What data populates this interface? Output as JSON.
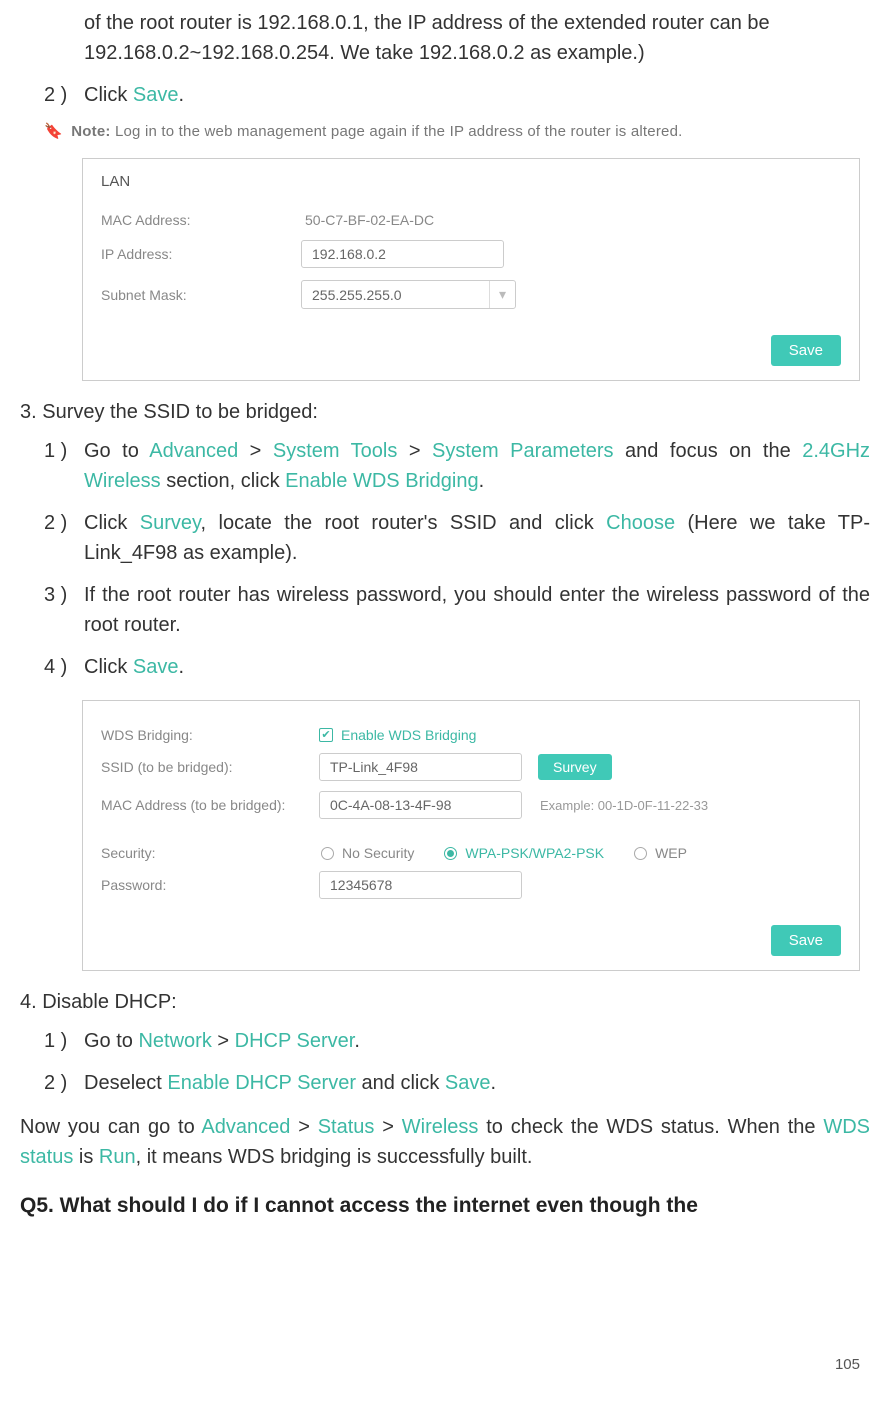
{
  "topContinuation": "of the root router is 192.168.0.1, the IP address of the extended router can be 192.168.0.2~192.168.0.254. We take 192.168.0.2 as example.)",
  "step2_top": {
    "pre": "Click ",
    "hl": "Save",
    "post": "."
  },
  "note": {
    "label": "Note:",
    "text": " Log in to the web management page again if the IP address of the router is altered."
  },
  "lanPanel": {
    "title": "LAN",
    "mac": {
      "label": "MAC Address:",
      "value": "50-C7-BF-02-EA-DC"
    },
    "ip": {
      "label": "IP Address:",
      "value": "192.168.0.2"
    },
    "mask": {
      "label": "Subnet Mask:",
      "value": "255.255.255.0"
    },
    "save": "Save"
  },
  "section3_title": "3. Survey the SSID to be bridged:",
  "s3_1": {
    "pre": "Go to ",
    "h1": "Advanced",
    "m1": " > ",
    "h2": "System Tools",
    "m2": " > ",
    "h3": "System Parameters",
    "mid": " and focus on the ",
    "h4": "2.4GHz Wireless",
    "mid2": " section, click ",
    "h5": "Enable WDS Bridging",
    "post": "."
  },
  "s3_2": {
    "pre": "Click ",
    "h1": "Survey",
    "mid": ", locate the root router's SSID and click ",
    "h2": "Choose",
    "post": " (Here we take TP-Link_4F98 as example)."
  },
  "s3_3": "If the root router has wireless password, you should enter the wireless password of the root router.",
  "s3_4": {
    "pre": "Click ",
    "hl": "Save",
    "post": "."
  },
  "wdsPanel": {
    "bridging": {
      "label": "WDS Bridging:",
      "checkbox": "Enable WDS Bridging"
    },
    "ssid": {
      "label": "SSID (to be bridged):",
      "value": "TP-Link_4F98",
      "survey": "Survey"
    },
    "mac": {
      "label": "MAC Address (to be bridged):",
      "value": "0C-4A-08-13-4F-98",
      "example": "Example: 00-1D-0F-11-22-33"
    },
    "security": {
      "label": "Security:",
      "opt1": "No Security",
      "opt2": "WPA-PSK/WPA2-PSK",
      "opt3": "WEP"
    },
    "password": {
      "label": "Password:",
      "value": "12345678"
    },
    "save": "Save"
  },
  "section4_title": "4. Disable DHCP:",
  "s4_1": {
    "pre": "Go to ",
    "h1": "Network",
    "m1": " > ",
    "h2": "DHCP Server",
    "post": "."
  },
  "s4_2": {
    "pre": "Deselect ",
    "h1": "Enable DHCP Server",
    "mid": " and click ",
    "h2": "Save",
    "post": "."
  },
  "closing": {
    "p1_a": "Now you can go to ",
    "h1": "Advanced",
    "m1": " > ",
    "h2": "Status",
    "m2": " > ",
    "h3": "Wireless",
    "p1_b": " to check the WDS status. When the ",
    "h4": "WDS status",
    "p1_c": " is ",
    "h5": "Run",
    "p1_d": ", it means WDS bridging is successfully built."
  },
  "q5": "Q5. What should I do if I cannot access the internet even though the",
  "pageNum": "105"
}
